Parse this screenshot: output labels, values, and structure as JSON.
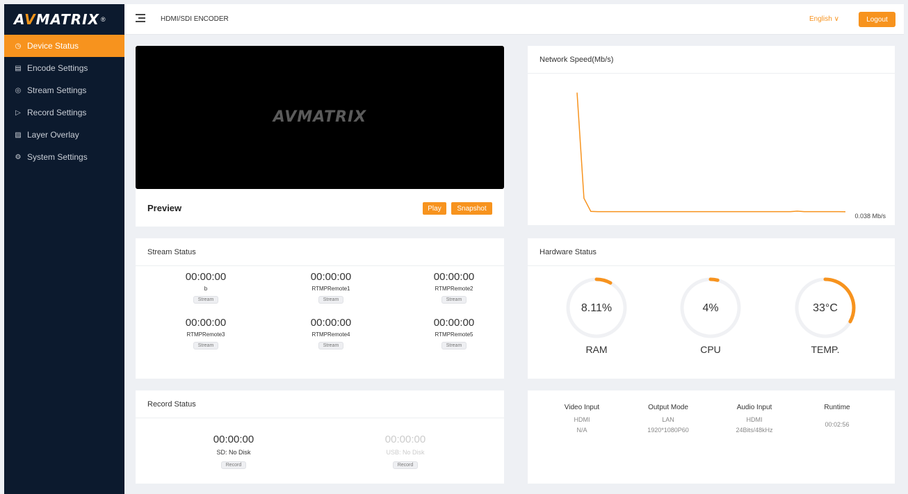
{
  "sidebar": {
    "logo": {
      "part1": "A",
      "part2": "V",
      "part3": "MATRIX",
      "mark": "®"
    },
    "items": [
      {
        "label": "Device Status",
        "icon": "clock-icon",
        "glyph": "◷",
        "active": true
      },
      {
        "label": "Encode Settings",
        "icon": "list-icon",
        "glyph": "▤",
        "active": false
      },
      {
        "label": "Stream Settings",
        "icon": "eye-icon",
        "glyph": "◎",
        "active": false
      },
      {
        "label": "Record Settings",
        "icon": "record-icon",
        "glyph": "▷",
        "active": false
      },
      {
        "label": "Layer Overlay",
        "icon": "image-icon",
        "glyph": "▨",
        "active": false
      },
      {
        "label": "System Settings",
        "icon": "gear-icon",
        "glyph": "⚙",
        "active": false
      }
    ]
  },
  "header": {
    "title": "HDMI/SDI ENCODER",
    "language": "English ∨",
    "logout": "Logout"
  },
  "preview": {
    "video_logo": "AVMATRIX",
    "label": "Preview",
    "play": "Play",
    "snapshot": "Snapshot"
  },
  "network": {
    "title": "Network Speed(Mb/s)",
    "current": "0.038 Mb/s"
  },
  "chart_data": {
    "type": "line",
    "title": "Network Speed(Mb/s)",
    "series": [
      {
        "values": [
          5.0,
          0.6,
          0.05,
          0.04,
          0.04,
          0.04,
          0.04,
          0.04,
          0.04,
          0.04,
          0.04,
          0.04,
          0.04,
          0.04,
          0.04,
          0.04,
          0.04,
          0.04,
          0.04,
          0.04,
          0.04,
          0.04,
          0.04,
          0.04,
          0.04,
          0.04,
          0.04,
          0.04,
          0.04,
          0.04,
          0.04,
          0.04,
          0.06,
          0.04,
          0.04,
          0.04,
          0.04,
          0.04,
          0.04,
          0.038
        ]
      }
    ],
    "ylim": [
      0,
      5.5
    ],
    "grid": false,
    "color": "#f7931e"
  },
  "stream": {
    "title": "Stream Status",
    "items": [
      {
        "time": "00:00:00",
        "name": "b",
        "button": "Stream"
      },
      {
        "time": "00:00:00",
        "name": "RTMPRemote1",
        "button": "Stream"
      },
      {
        "time": "00:00:00",
        "name": "RTMPRemote2",
        "button": "Stream"
      },
      {
        "time": "00:00:00",
        "name": "RTMPRemote3",
        "button": "Stream"
      },
      {
        "time": "00:00:00",
        "name": "RTMPRemote4",
        "button": "Stream"
      },
      {
        "time": "00:00:00",
        "name": "RTMPRemote5",
        "button": "Stream"
      }
    ]
  },
  "hardware": {
    "title": "Hardware Status",
    "gauges": [
      {
        "value": "8.11%",
        "label": "RAM",
        "fraction": 0.0811
      },
      {
        "value": "4%",
        "label": "CPU",
        "fraction": 0.04
      },
      {
        "value": "33°C",
        "label": "TEMP.",
        "fraction": 0.33
      }
    ],
    "accent": "#f7931e",
    "track": "#f0f1f4"
  },
  "record": {
    "title": "Record Status",
    "items": [
      {
        "time": "00:00:00",
        "disk": "SD: No Disk",
        "button": "Record",
        "enabled": true
      },
      {
        "time": "00:00:00",
        "disk": "USB: No Disk",
        "button": "Record",
        "enabled": false
      }
    ]
  },
  "info": {
    "columns": [
      {
        "head": "Video Input",
        "lines": [
          "HDMI",
          "N/A"
        ]
      },
      {
        "head": "Output Mode",
        "lines": [
          "LAN",
          "1920*1080P60"
        ]
      },
      {
        "head": "Audio Input",
        "lines": [
          "HDMI",
          "24Bits/48kHz"
        ]
      },
      {
        "head": "Runtime",
        "lines": [
          "00:02:56"
        ]
      }
    ]
  }
}
